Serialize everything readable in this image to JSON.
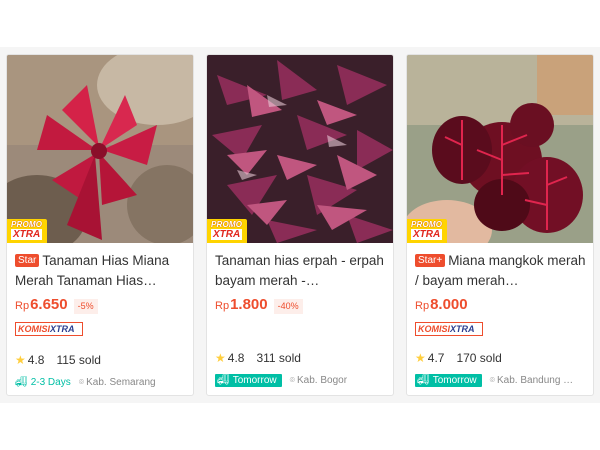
{
  "products": [
    {
      "promo_line1": "PROMO",
      "promo_line2": "XTRA",
      "badge": "Star",
      "title": "Tanaman Hias Miana Merah Tanaman Hias…",
      "currency": "Rp",
      "price": "6.650",
      "discount": "-5%",
      "komisi_part1": "KOMISI",
      "komisi_part2": "XTRA",
      "rating": "4.8",
      "sold": "115 sold",
      "delivery": "2-3 Days",
      "location": "Kab. Semarang"
    },
    {
      "promo_line1": "PROMO",
      "promo_line2": "XTRA",
      "badge": "",
      "title": "Tanaman hias erpah - erpah bayam merah -…",
      "currency": "Rp",
      "price": "1.800",
      "discount": "-40%",
      "komisi_part1": "",
      "komisi_part2": "",
      "rating": "4.8",
      "sold": "311 sold",
      "delivery": "Tomorrow",
      "location": "Kab. Bogor"
    },
    {
      "promo_line1": "PROMO",
      "promo_line2": "XTRA",
      "badge": "Star+",
      "title": "Miana mangkok merah / bayam merah…",
      "currency": "Rp",
      "price": "8.000",
      "discount": "",
      "komisi_part1": "KOMISI",
      "komisi_part2": "XTRA",
      "rating": "4.7",
      "sold": "170 sold",
      "delivery": "Tomorrow",
      "location": "Kab. Bandung …"
    }
  ],
  "icons": {
    "star": "star-icon",
    "truck": "truck-icon",
    "pin": "location-pin-icon"
  },
  "colors": {
    "accent": "#ee4d2d",
    "shipping": "#00bfa5",
    "rating_star": "#ffce3d",
    "promo_yellow": "#ffd400"
  }
}
